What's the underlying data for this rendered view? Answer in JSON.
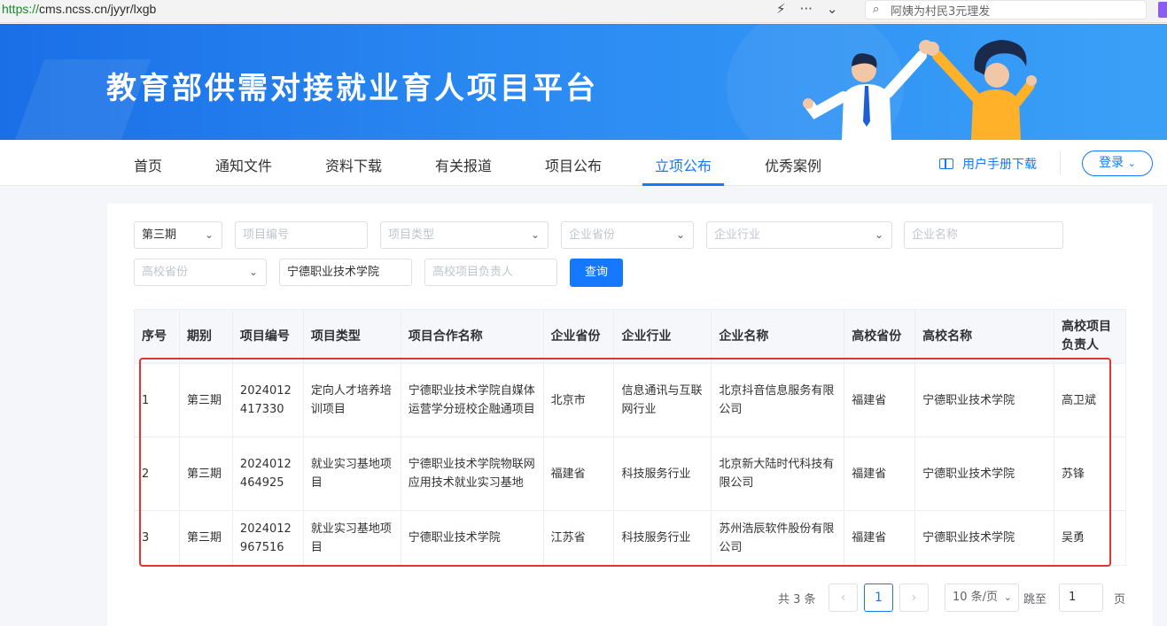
{
  "browser": {
    "url_scheme": "https://",
    "url_rest": "cms.ncss.cn/jyyr/lxgb",
    "search_text": "阿姨为村民3元理发",
    "icons": [
      "lightning-icon",
      "more-icon",
      "chevron-down-icon",
      "search-icon"
    ]
  },
  "banner": {
    "title": "教育部供需对接就业育人项目平台"
  },
  "nav": {
    "items": [
      "首页",
      "通知文件",
      "资料下载",
      "有关报道",
      "项目公布",
      "立项公布",
      "优秀案例"
    ],
    "active": "立项公布",
    "manual": "用户手册下载",
    "login": "登录"
  },
  "filters": {
    "period": "第三期",
    "project_no": "项目编号",
    "project_type": "项目类型",
    "company_province": "企业省份",
    "company_industry": "企业行业",
    "company_name": "企业名称",
    "school_province": "高校省份",
    "school_name": "宁德职业技术学院",
    "school_leader": "高校项目负责人",
    "query_label": "查询"
  },
  "table": {
    "headers": [
      "序号",
      "期别",
      "项目编号",
      "项目类型",
      "项目合作名称",
      "企业省份",
      "企业行业",
      "企业名称",
      "高校省份",
      "高校名称",
      "高校项目负责人"
    ],
    "rows": [
      [
        "1",
        "第三期",
        "2024012417330",
        "定向人才培养培训项目",
        "宁德职业技术学院自媒体运营学分班校企融通项目",
        "北京市",
        "信息通讯与互联网行业",
        "北京抖音信息服务有限公司",
        "福建省",
        "宁德职业技术学院",
        "高卫斌"
      ],
      [
        "2",
        "第三期",
        "2024012464925",
        "就业实习基地项目",
        "宁德职业技术学院物联网应用技术就业实习基地",
        "福建省",
        "科技服务行业",
        "北京新大陆时代科技有限公司",
        "福建省",
        "宁德职业技术学院",
        "苏锋"
      ],
      [
        "3",
        "第三期",
        "2024012967516",
        "就业实习基地项目",
        "宁德职业技术学院",
        "江苏省",
        "科技服务行业",
        "苏州浩辰软件股份有限公司",
        "福建省",
        "宁德职业技术学院",
        "吴勇"
      ]
    ]
  },
  "pagination": {
    "total": "共 3 条",
    "prev": "‹",
    "current": "1",
    "next": "›",
    "page_size": "10 条/页",
    "jump_label": "跳至",
    "jump_value": "1",
    "page_suffix": "页"
  },
  "colors": {
    "accent": "#1677ff",
    "highlight_box": "#e8322f"
  }
}
